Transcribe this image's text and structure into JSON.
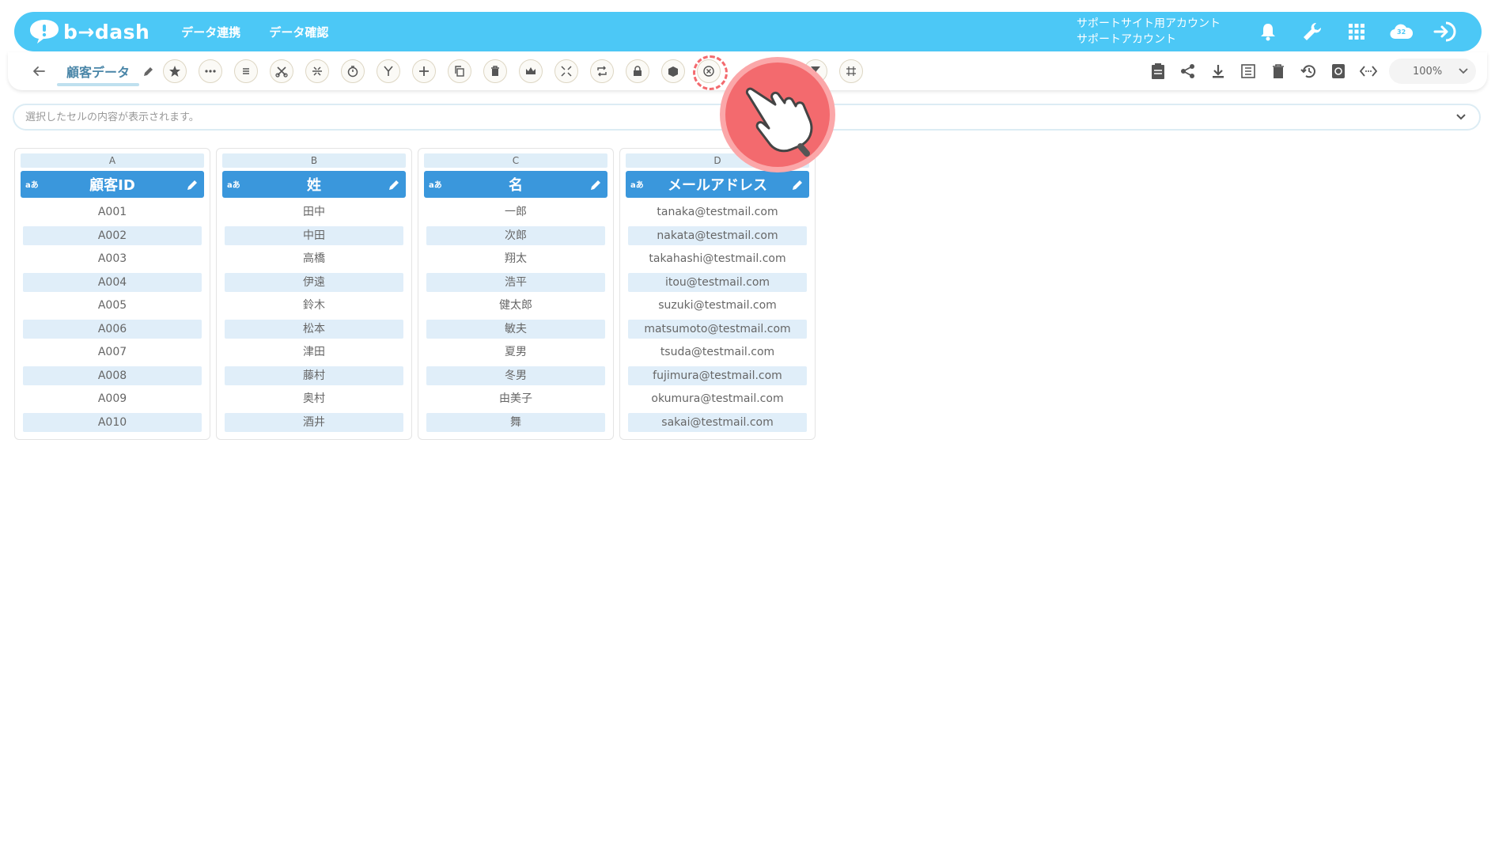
{
  "header": {
    "logo_text": "b→dash",
    "nav": [
      "データ連携",
      "データ確認"
    ],
    "account_line1": "サポートサイト用アカウント",
    "account_line2": "サポートアカウント",
    "icons": [
      "bell-icon",
      "wrench-icon",
      "apps-grid-icon",
      "cloud-icon",
      "logout-icon"
    ],
    "cloud_badge": "32"
  },
  "toolbar": {
    "sheet_name": "顧客データ",
    "tools": [
      "star-icon",
      "more-horizontal-icon",
      "list-icon",
      "cut-join-icon",
      "split-icon",
      "timer-icon",
      "merge-icon",
      "plus-icon",
      "copy-icon",
      "trash-icon",
      "crown-icon",
      "expand-icon",
      "repeat-icon",
      "lock-icon",
      "box-icon",
      "close-circle-icon",
      "filter-icon",
      "hash-icon"
    ],
    "highlighted_tool": "close-circle-icon",
    "right_tools": [
      "clipboard-icon",
      "share-icon",
      "download-icon",
      "table-list-icon",
      "delete-icon",
      "history-icon",
      "refresh-doc-icon",
      "code-icon"
    ],
    "zoom": "100%"
  },
  "formula_bar": {
    "placeholder": "選択したセルの内容が表示されます。"
  },
  "columns": [
    {
      "letter": "A",
      "title": "顧客ID",
      "badge": "aあ",
      "values": [
        "A001",
        "A002",
        "A003",
        "A004",
        "A005",
        "A006",
        "A007",
        "A008",
        "A009",
        "A010"
      ]
    },
    {
      "letter": "B",
      "title": "姓",
      "badge": "aあ",
      "values": [
        "田中",
        "中田",
        "高橋",
        "伊遠",
        "鈴木",
        "松本",
        "津田",
        "藤村",
        "奥村",
        "酒井"
      ]
    },
    {
      "letter": "C",
      "title": "名",
      "badge": "aあ",
      "values": [
        "一郎",
        "次郎",
        "翔太",
        "浩平",
        "健太郎",
        "敏夫",
        "夏男",
        "冬男",
        "由美子",
        "舞"
      ]
    },
    {
      "letter": "D",
      "title": "メールアドレス",
      "badge": "aあ",
      "values": [
        "tanaka@testmail.com",
        "nakata@testmail.com",
        "takahashi@testmail.com",
        "itou@testmail.com",
        "suzuki@testmail.com",
        "matsumoto@testmail.com",
        "tsuda@testmail.com",
        "fujimura@testmail.com",
        "okumura@testmail.com",
        "sakai@testmail.com"
      ]
    }
  ],
  "colors": {
    "header_bg": "#4cc8f6",
    "column_header": "#3a97dc",
    "alt_row": "#e0eef9",
    "highlight": "#f36a6e"
  }
}
